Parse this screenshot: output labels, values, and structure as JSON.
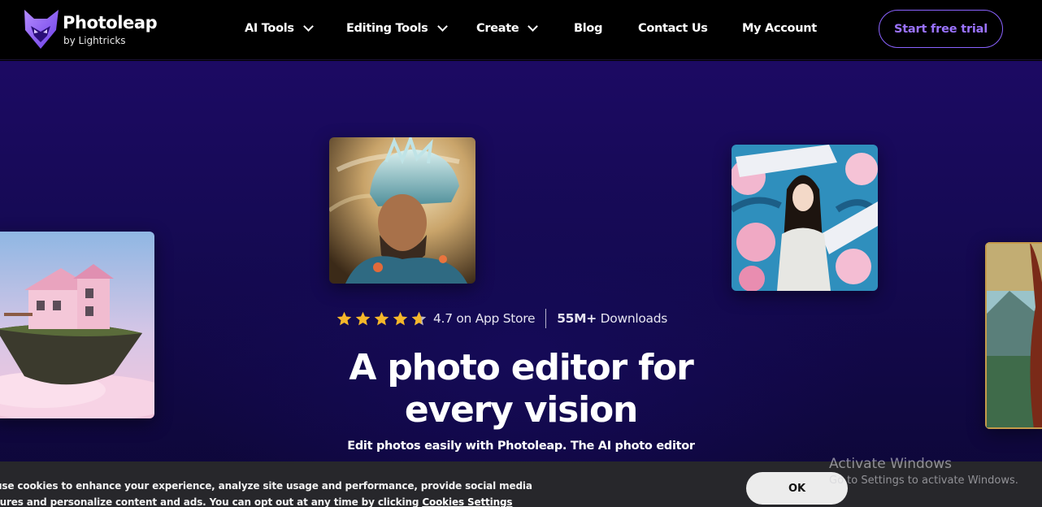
{
  "brand": {
    "name": "Photoleap",
    "byline": "by Lightricks",
    "accent_color": "#8a62ff",
    "logo_icon": "fox-logo-icon"
  },
  "nav": {
    "items": [
      {
        "label": "AI Tools",
        "has_dropdown": true
      },
      {
        "label": "Editing Tools",
        "has_dropdown": true
      },
      {
        "label": "Create",
        "has_dropdown": true
      },
      {
        "label": "Blog",
        "has_dropdown": false
      },
      {
        "label": "Contact Us",
        "has_dropdown": false
      },
      {
        "label": "My Account",
        "has_dropdown": false
      }
    ],
    "cta_label": "Start free trial"
  },
  "hero": {
    "rating": {
      "stars": 4.7,
      "max_stars": 5,
      "text": "4.7 on App Store",
      "star_color": "#f5b72a"
    },
    "downloads": {
      "count": "55M+",
      "label": "Downloads"
    },
    "headline_line1": "A photo editor for",
    "headline_line2": "every vision",
    "subheadline": "Edit photos easily with Photoleap. The AI photo editor",
    "images": [
      {
        "name": "warrior-portrait-image"
      },
      {
        "name": "floral-collage-image"
      },
      {
        "name": "floating-island-house-image"
      },
      {
        "name": "landscape-painting-image"
      }
    ]
  },
  "cookie_banner": {
    "line1": " use cookies to enhance your experience, analyze site usage and performance, provide social media",
    "line2": "tures and personalize content and ads. You can opt out at any time by clicking",
    "link": "Cookies Settings",
    "ok_label": "OK"
  },
  "os_watermark": {
    "title": "Activate Windows",
    "subtitle": "Go to Settings to activate Windows."
  }
}
